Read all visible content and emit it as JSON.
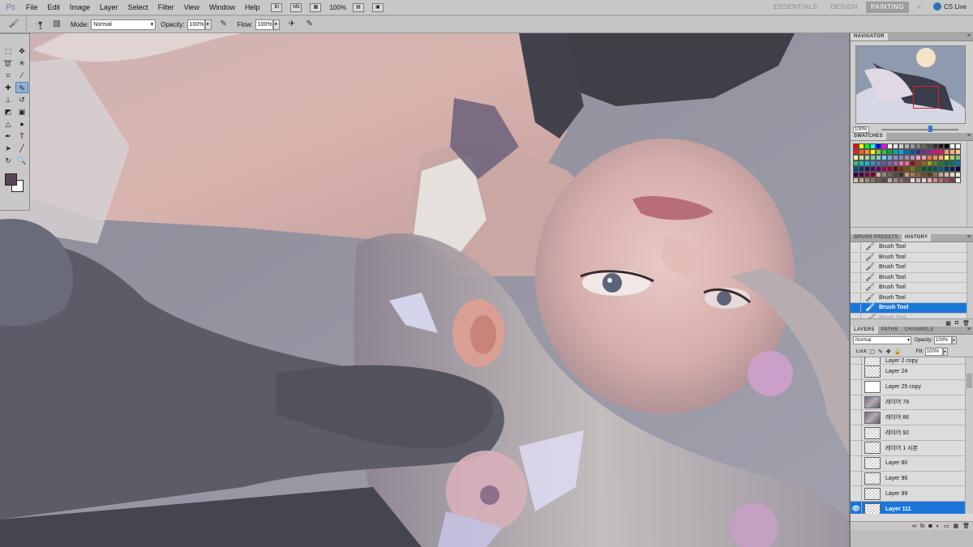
{
  "app": {
    "logo": "Ps",
    "menus": [
      "File",
      "Edit",
      "Image",
      "Layer",
      "Select",
      "Filter",
      "View",
      "Window",
      "Help"
    ],
    "zoom": "100%",
    "workspaces": [
      {
        "label": "ESSENTIALS",
        "active": false
      },
      {
        "label": "DESIGN",
        "active": false
      },
      {
        "label": "PAINTING",
        "active": true
      }
    ],
    "overflow": "»",
    "cs_live": "CS Live"
  },
  "options_bar": {
    "brush_size": "1",
    "mode_label": "Mode:",
    "mode_value": "Normal",
    "opacity_label": "Opacity:",
    "opacity_value": "100%",
    "flow_label": "Flow:",
    "flow_value": "100%"
  },
  "navigator": {
    "tab": "NAVIGATOR",
    "zoom": "100%"
  },
  "swatches": {
    "tab": "SWATCHES",
    "colors": [
      "#ff0000",
      "#ffff00",
      "#00ff00",
      "#00ffff",
      "#0000ff",
      "#ff00ff",
      "#ffffff",
      "#e6e6e6",
      "#cccccc",
      "#b3b3b3",
      "#999999",
      "#808080",
      "#666666",
      "#4d4d4d",
      "#333333",
      "#1a1a1a",
      "#000000",
      "#ffffff",
      "#ffffff",
      "#ed1c24",
      "#f26522",
      "#f7941d",
      "#fff200",
      "#8dc63f",
      "#39b54a",
      "#00a651",
      "#00a99d",
      "#00aeef",
      "#0072bc",
      "#0054a6",
      "#2e3192",
      "#662d91",
      "#92278f",
      "#ec008c",
      "#ed145b",
      "#f7977a",
      "#f9ad81",
      "#fdc68a",
      "#fff79a",
      "#c4df9b",
      "#a3d39c",
      "#82ca9d",
      "#7bcdc8",
      "#6ecff6",
      "#7ea7d8",
      "#8493ca",
      "#8882be",
      "#a187be",
      "#bc8dbf",
      "#f49ac2",
      "#f6989d",
      "#f26c4f",
      "#f68e55",
      "#fbaf5c",
      "#fff467",
      "#acd372",
      "#7cc576",
      "#3bb878",
      "#1abbb4",
      "#00bff3",
      "#438ccb",
      "#5574b9",
      "#605ca8",
      "#855fa8",
      "#a763a8",
      "#f06eaa",
      "#f26d7d",
      "#9e0b0f",
      "#a0410d",
      "#a36209",
      "#aba000",
      "#598527",
      "#1a7b30",
      "#007236",
      "#00746b",
      "#0076a3",
      "#004b80",
      "#003471",
      "#1b1464",
      "#440e62",
      "#630460",
      "#9e005d",
      "#9e0039",
      "#790000",
      "#7b2e00",
      "#7d4900",
      "#827b00",
      "#406618",
      "#005e20",
      "#005826",
      "#005952",
      "#005b7f",
      "#003663",
      "#002157",
      "#0d004c",
      "#32004b",
      "#4b0049",
      "#7b0046",
      "#7a0026",
      "#c7b299",
      "#998675",
      "#736357",
      "#534741",
      "#37302a",
      "#c69c6d",
      "#a67c52",
      "#8c6239",
      "#754c24",
      "#603913",
      "#8a6d5c",
      "#c3a99a",
      "#d9b8a8",
      "#ead7c6",
      "#f2e4d8",
      "#d9c2b3",
      "#bfa596",
      "#a68c7f",
      "#8c7366",
      "#735a4d",
      "#5e4a40",
      "#c4a2a7",
      "#a8868d",
      "#8c6a72",
      "#6e5058",
      "#e8d6d8",
      "#cbb3b8",
      "#f0ccd3",
      "#e0a7b1",
      "#d1858f",
      "#b46a75",
      "#9a5460",
      "#7d3f4a",
      "#ffffff"
    ]
  },
  "history": {
    "tabs": [
      {
        "label": "BRUSH PRESETS",
        "active": false
      },
      {
        "label": "HISTORY",
        "active": true
      }
    ],
    "items": [
      {
        "label": "Brush Tool",
        "state": "normal"
      },
      {
        "label": "Brush Tool",
        "state": "normal"
      },
      {
        "label": "Brush Tool",
        "state": "normal"
      },
      {
        "label": "Brush Tool",
        "state": "normal"
      },
      {
        "label": "Brush Tool",
        "state": "normal"
      },
      {
        "label": "Brush Tool",
        "state": "normal"
      },
      {
        "label": "Brush Tool",
        "state": "selected"
      },
      {
        "label": "Brush Tool",
        "state": "undone"
      }
    ]
  },
  "layers": {
    "tabs": [
      {
        "label": "LAYERS",
        "active": true
      },
      {
        "label": "PATHS",
        "active": false
      },
      {
        "label": "CHANNELS",
        "active": false
      }
    ],
    "blend_mode": "Normal",
    "opacity_label": "Opacity:",
    "opacity_value": "100%",
    "lock_label": "Lock:",
    "fill_label": "Fill:",
    "fill_value": "100%",
    "items": [
      {
        "name": "Layer 2 copy",
        "thumb": "transparent",
        "visible": false,
        "selected": false,
        "partial": true
      },
      {
        "name": "Layer 24",
        "thumb": "transparent",
        "visible": false,
        "selected": false
      },
      {
        "name": "Layer 25 copy",
        "thumb": "white",
        "visible": false,
        "selected": false
      },
      {
        "name": "레이어 78",
        "thumb": "image",
        "visible": false,
        "selected": false
      },
      {
        "name": "레이어 86",
        "thumb": "image",
        "visible": false,
        "selected": false
      },
      {
        "name": "레이어 92",
        "thumb": "transparent",
        "visible": false,
        "selected": false
      },
      {
        "name": "레이어 1 사본",
        "thumb": "transparent",
        "visible": false,
        "selected": false
      },
      {
        "name": "Layer 80",
        "thumb": "transparent",
        "visible": false,
        "selected": false
      },
      {
        "name": "Layer 96",
        "thumb": "transparent",
        "visible": false,
        "selected": false
      },
      {
        "name": "Layer 99",
        "thumb": "transparent",
        "visible": false,
        "selected": false
      },
      {
        "name": "Layer 111",
        "thumb": "transparent",
        "visible": true,
        "selected": true
      }
    ]
  }
}
